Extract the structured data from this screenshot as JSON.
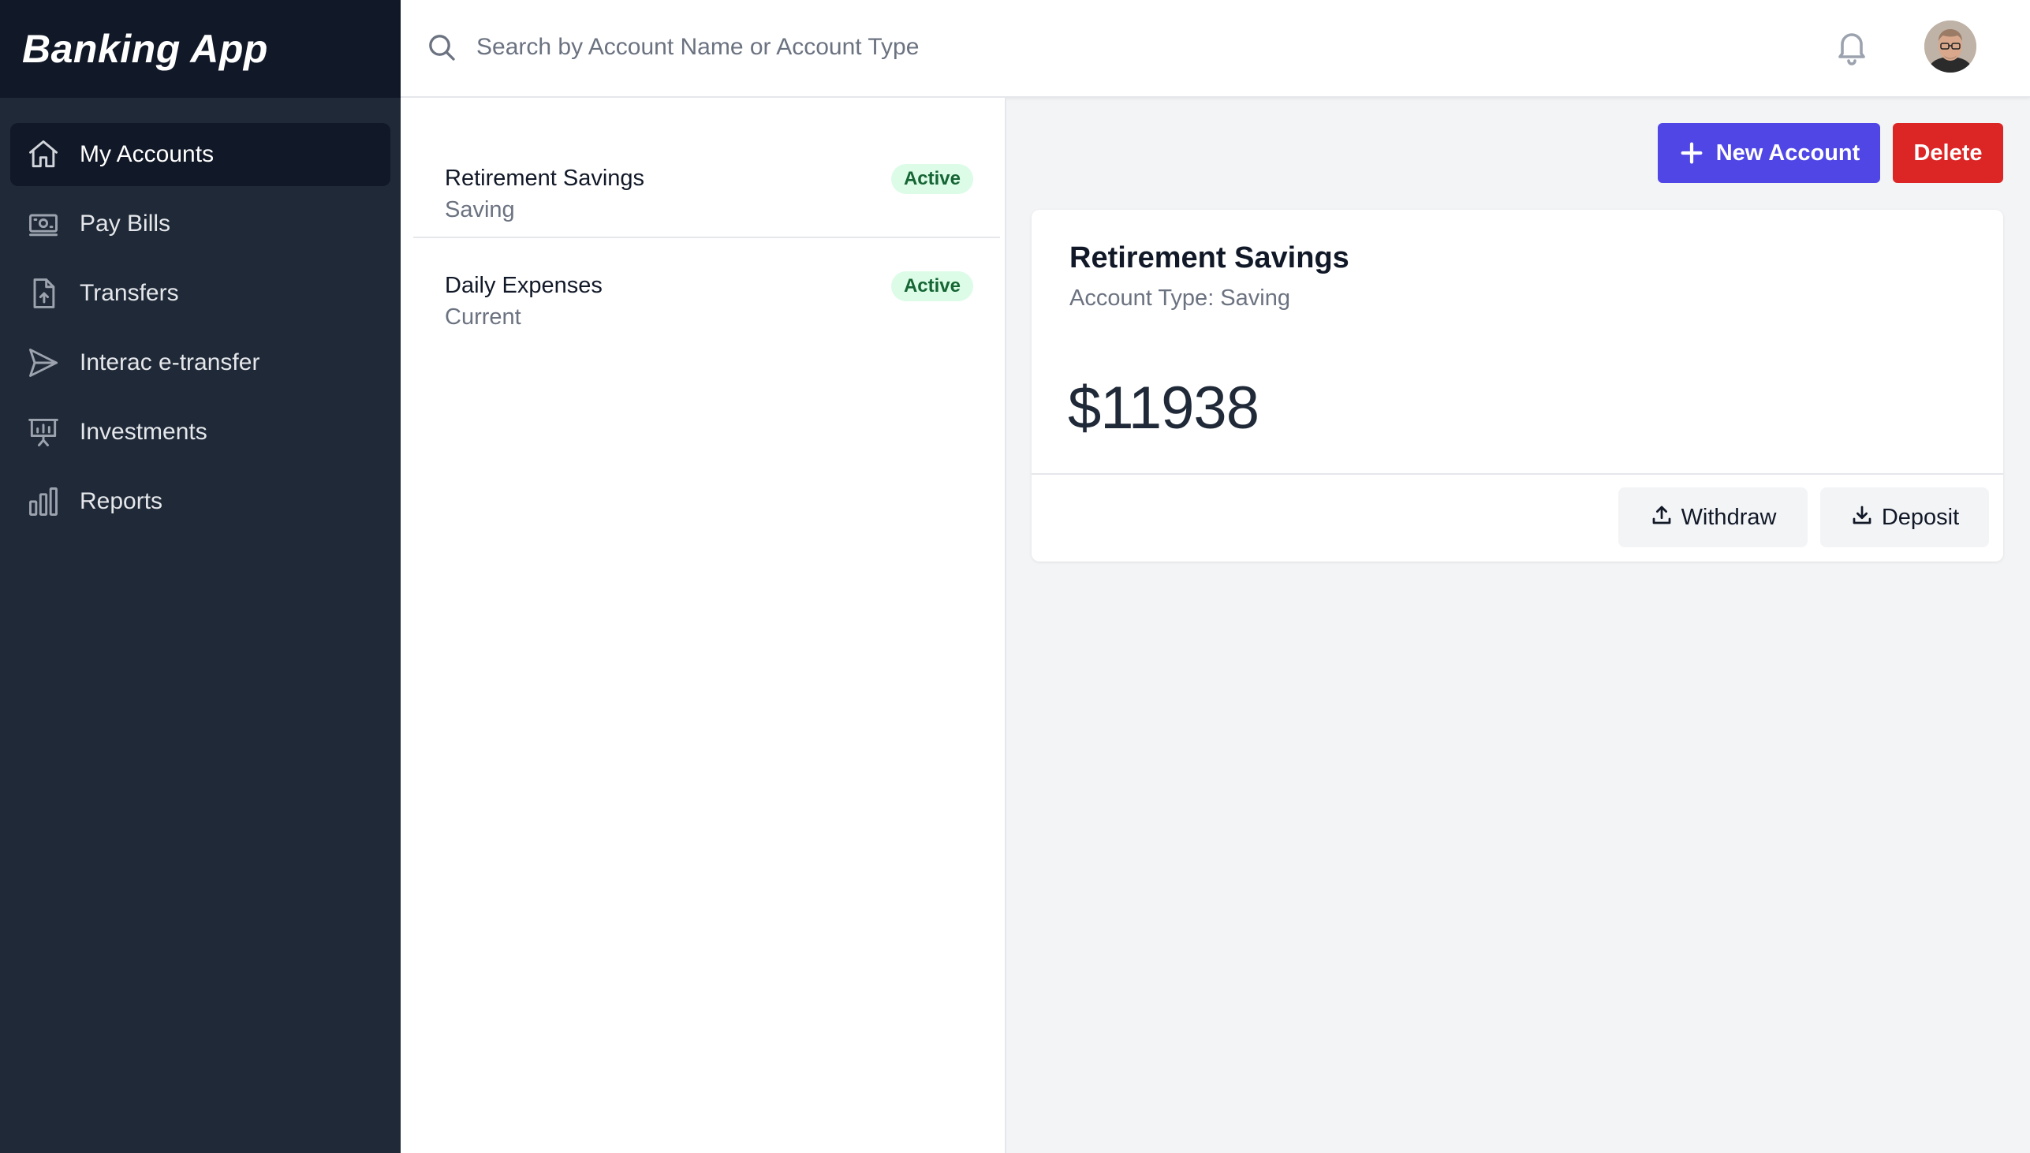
{
  "app": {
    "title": "Banking App"
  },
  "sidebar": {
    "items": [
      {
        "label": "My Accounts",
        "icon": "home-icon",
        "active": true
      },
      {
        "label": "Pay Bills",
        "icon": "cash-icon",
        "active": false
      },
      {
        "label": "Transfers",
        "icon": "document-upload-icon",
        "active": false
      },
      {
        "label": "Interac e-transfer",
        "icon": "paper-plane-icon",
        "active": false
      },
      {
        "label": "Investments",
        "icon": "presentation-chart-icon",
        "active": false
      },
      {
        "label": "Reports",
        "icon": "bar-chart-icon",
        "active": false
      }
    ]
  },
  "header": {
    "search_placeholder": "Search by Account Name or Account Type",
    "search_value": ""
  },
  "accounts": [
    {
      "name": "Retirement Savings",
      "type": "Saving",
      "status": "Active"
    },
    {
      "name": "Daily Expenses",
      "type": "Current",
      "status": "Active"
    }
  ],
  "toolbar": {
    "new_label": "New Account",
    "delete_label": "Delete"
  },
  "detail": {
    "name": "Retirement Savings",
    "type_line": "Account Type: Saving",
    "balance": "$11938",
    "withdraw_label": "Withdraw",
    "deposit_label": "Deposit"
  },
  "colors": {
    "sidebar_bg": "#1f2937",
    "brand_bg": "#111827",
    "primary": "#4f46e5",
    "danger": "#dc2626",
    "badge_bg": "#dcfce7",
    "badge_text": "#166534"
  }
}
